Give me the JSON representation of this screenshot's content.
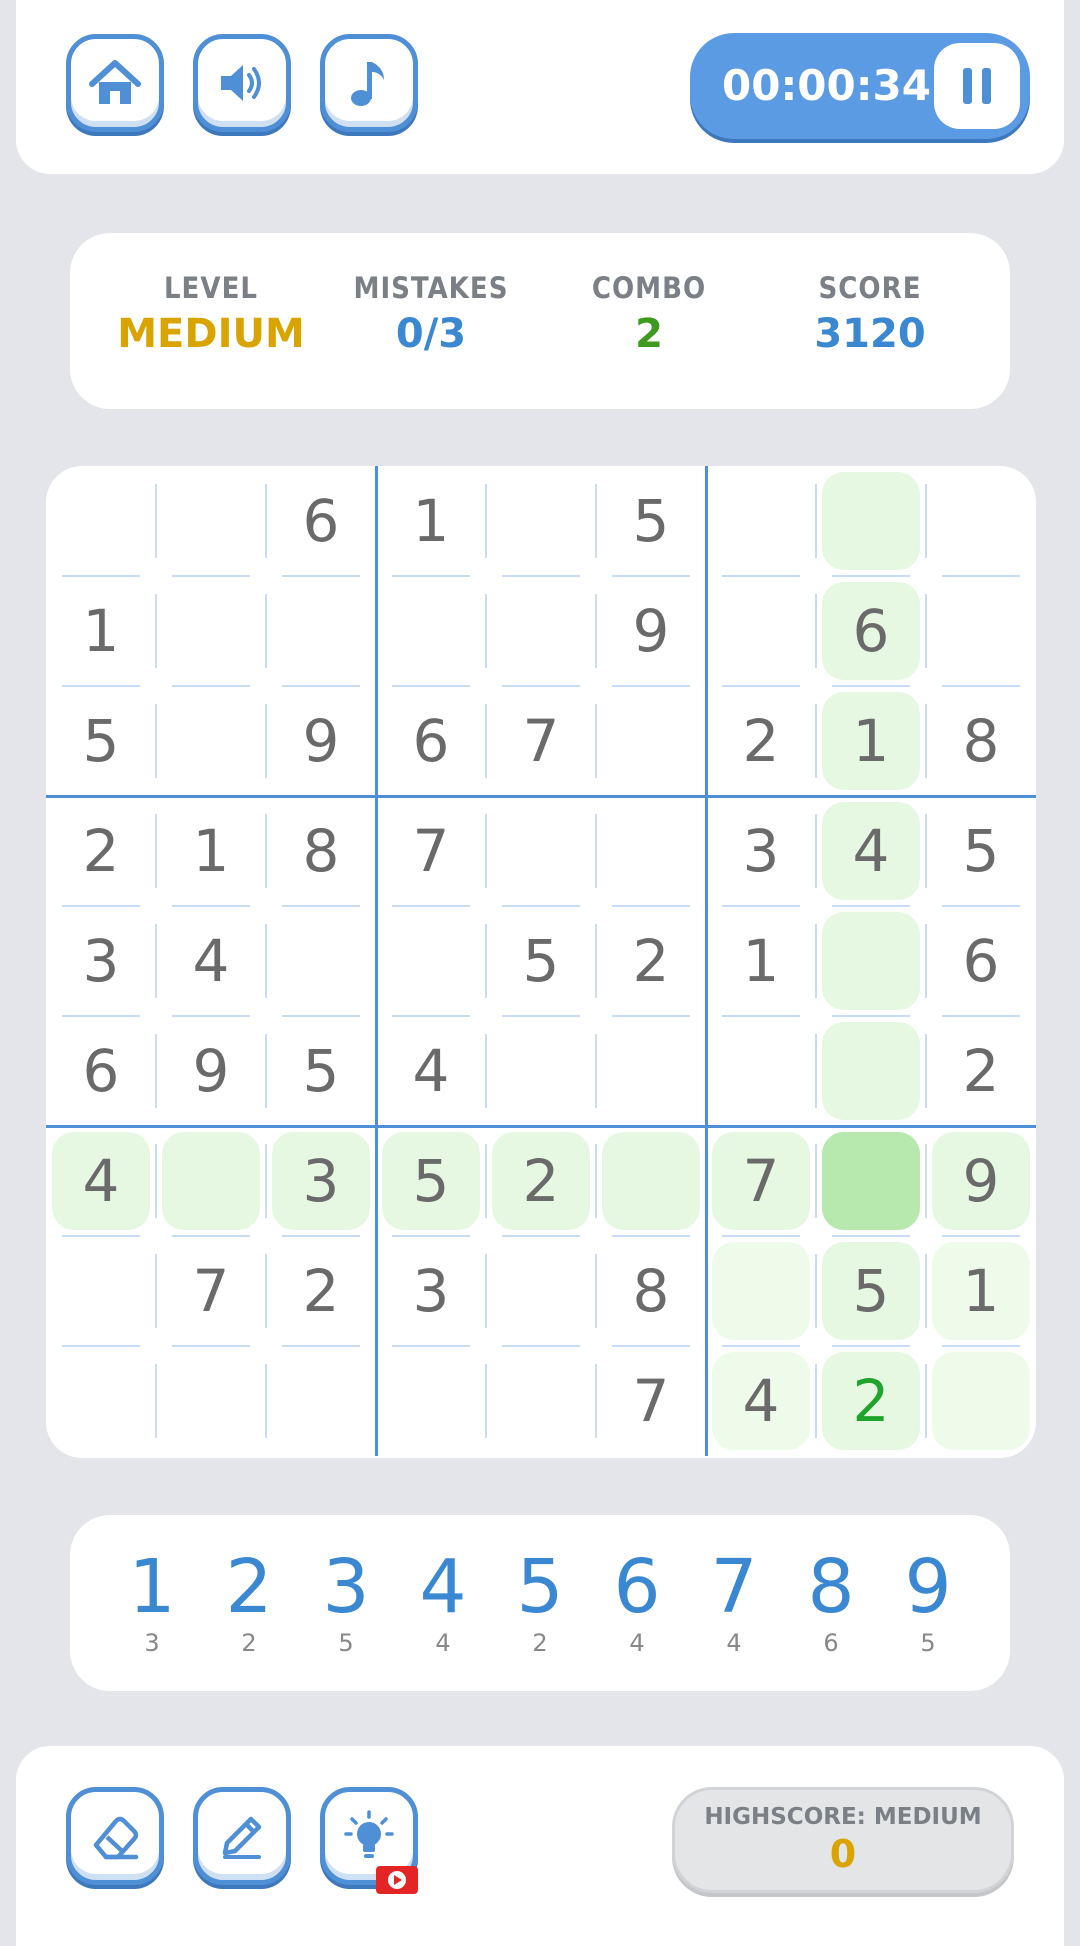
{
  "toolbar": {
    "home_icon": "home-icon",
    "sound_icon": "speaker-icon",
    "music_icon": "music-note-icon",
    "timer": "00:00:34",
    "pause_icon": "pause-icon"
  },
  "stats": {
    "level_label": "LEVEL",
    "level_value": "MEDIUM",
    "mistakes_label": "MISTAKES",
    "mistakes_value": "0/3",
    "combo_label": "COMBO",
    "combo_value": "2",
    "score_label": "SCORE",
    "score_value": "3120"
  },
  "colors": {
    "accent_blue": "#3a87d2",
    "level_gold": "#d9a400",
    "combo_green": "#3d9a1e",
    "user_entry_green": "#1fa52c",
    "highlight_green": "#e6f8e2",
    "selected_green": "#b7e8ad"
  },
  "board": {
    "rows": [
      [
        "",
        "",
        "6",
        "1",
        "",
        "5",
        "",
        "",
        ""
      ],
      [
        "1",
        "",
        "",
        "",
        "",
        "9",
        "",
        "6",
        ""
      ],
      [
        "5",
        "",
        "9",
        "6",
        "7",
        "",
        "2",
        "1",
        "8"
      ],
      [
        "2",
        "1",
        "8",
        "7",
        "",
        "",
        "3",
        "4",
        "5"
      ],
      [
        "3",
        "4",
        "",
        "",
        "5",
        "2",
        "1",
        "",
        "6"
      ],
      [
        "6",
        "9",
        "5",
        "4",
        "",
        "",
        "",
        "",
        "2"
      ],
      [
        "4",
        "",
        "3",
        "5",
        "2",
        "",
        "7",
        "",
        "9"
      ],
      [
        "",
        "7",
        "2",
        "3",
        "",
        "8",
        "",
        "5",
        "1"
      ],
      [
        "",
        "",
        "",
        "",
        "",
        "7",
        "4",
        "2",
        ""
      ]
    ],
    "selected_cell": [
      6,
      7
    ],
    "user_entered_cells": [
      [
        8,
        7
      ]
    ]
  },
  "numpad": {
    "keys": [
      {
        "digit": "1",
        "remaining": "3"
      },
      {
        "digit": "2",
        "remaining": "2"
      },
      {
        "digit": "3",
        "remaining": "5"
      },
      {
        "digit": "4",
        "remaining": "4"
      },
      {
        "digit": "5",
        "remaining": "2"
      },
      {
        "digit": "6",
        "remaining": "4"
      },
      {
        "digit": "7",
        "remaining": "4"
      },
      {
        "digit": "8",
        "remaining": "6"
      },
      {
        "digit": "9",
        "remaining": "5"
      }
    ]
  },
  "tools": {
    "erase_icon": "eraser-icon",
    "notes_icon": "pencil-icon",
    "hint_icon": "lightbulb-icon",
    "ad_icon": "video-ad-icon"
  },
  "highscore": {
    "label": "HIGHSCORE: MEDIUM",
    "value": "0"
  }
}
